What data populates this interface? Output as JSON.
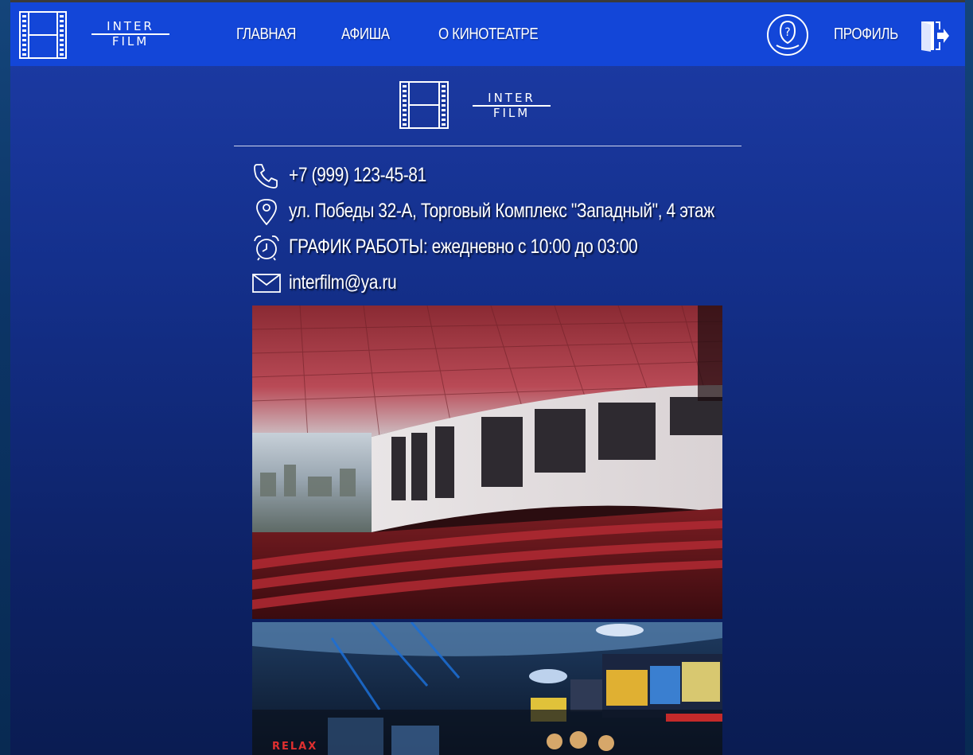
{
  "header": {
    "logo": {
      "line1": "INTER",
      "line2": "FILM"
    },
    "nav": {
      "main": "ГЛАВНАЯ",
      "afisha": "АФИША",
      "about": "О КИНОТЕАТРЕ",
      "profile": "ПРОФИЛЬ"
    }
  },
  "content": {
    "logo": {
      "line1": "INTER",
      "line2": "FILM"
    },
    "contacts": {
      "phone": "+7 (999) 123-45-81",
      "address": "ул. Победы 32-А, Торговый Комплекс \"Западный\", 4 этаж",
      "hours": "ГРАФИК РАБОТЫ: ежедневно с 10:00 до 03:00",
      "email": "interfilm@ya.ru"
    },
    "photo2_sign": "RELAX"
  },
  "icons": {
    "logo": "film-strip-icon",
    "help": "help-icon",
    "logout": "logout-icon",
    "phone": "phone-icon",
    "location": "location-pin-icon",
    "clock": "alarm-clock-icon",
    "mail": "mail-icon"
  },
  "colors": {
    "topbar": "#1346d8",
    "page_top": "#1d3ca8",
    "page_bottom": "#0a1c52"
  }
}
